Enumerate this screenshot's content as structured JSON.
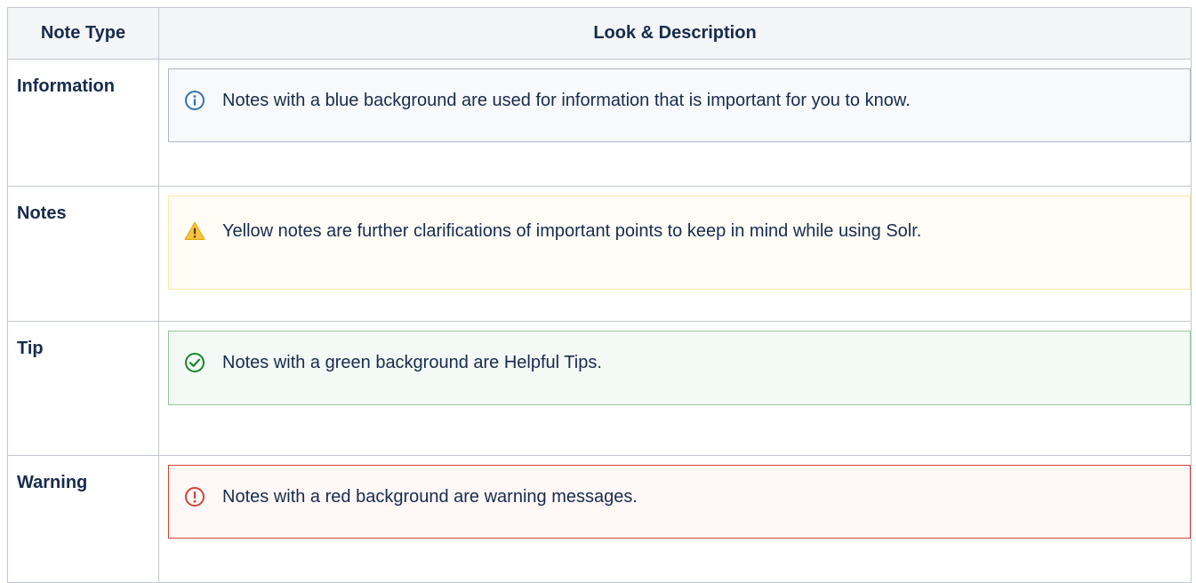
{
  "header": {
    "col1": "Note Type",
    "col2": "Look & Description"
  },
  "rows": [
    {
      "type": "Information",
      "text": "Notes with a blue background are used for information that is important for you to know.",
      "icon": "info-icon",
      "accent": "#3572b0"
    },
    {
      "type": "Notes",
      "text": "Yellow notes are further clarifications of important points to keep in mind while using Solr.",
      "icon": "warning-triangle-icon",
      "accent": "#f6c342"
    },
    {
      "type": "Tip",
      "text": "Notes with a green background are Helpful Tips.",
      "icon": "check-circle-icon",
      "accent": "#14892c"
    },
    {
      "type": "Warning",
      "text": "Notes with a red background are warning messages.",
      "icon": "error-icon",
      "accent": "#d04437"
    }
  ]
}
